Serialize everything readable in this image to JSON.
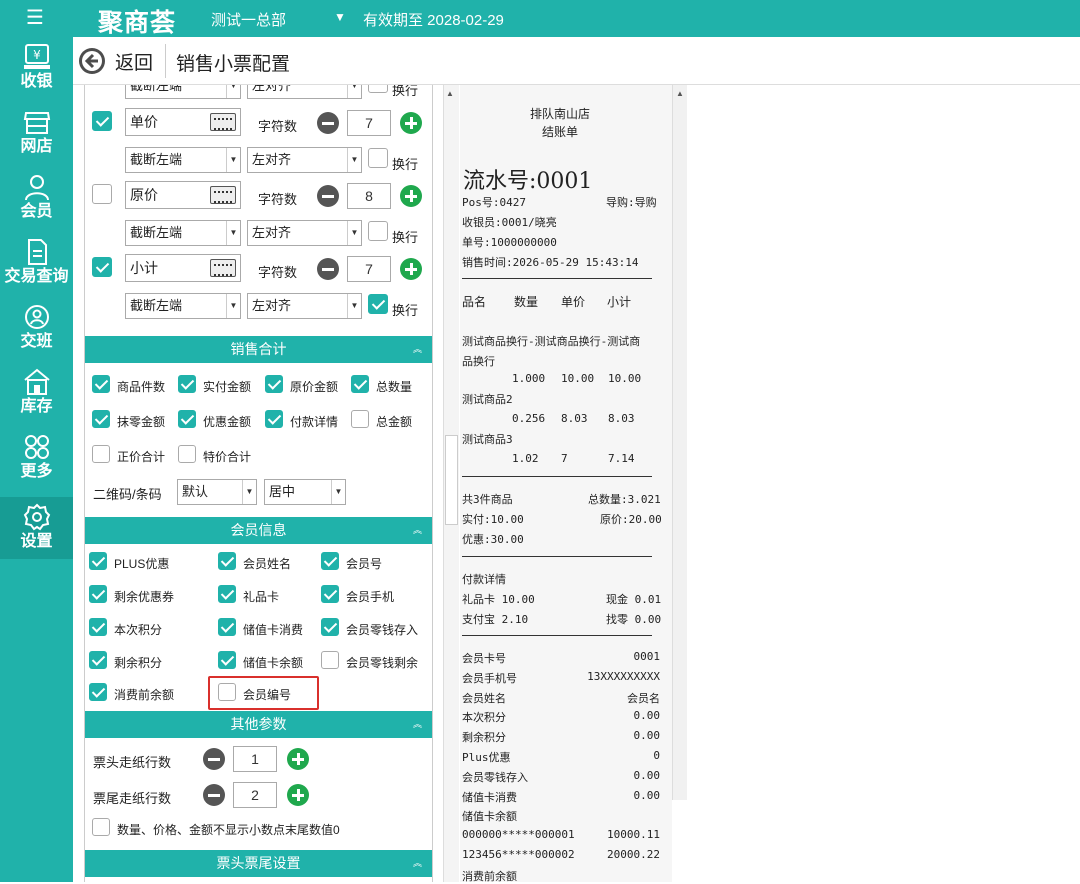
{
  "topbar": {
    "logo": "聚商荟",
    "store": "测试一总部",
    "expiry": "有效期至 2028-02-29"
  },
  "sidebar": {
    "items": [
      {
        "label": "收银",
        "icon": "cashier-icon"
      },
      {
        "label": "网店",
        "icon": "shop-icon"
      },
      {
        "label": "会员",
        "icon": "member-icon"
      },
      {
        "label": "交易查询",
        "icon": "transaction-icon"
      },
      {
        "label": "交班",
        "icon": "handover-icon"
      },
      {
        "label": "库存",
        "icon": "inventory-icon"
      },
      {
        "label": "更多",
        "icon": "more-icon"
      },
      {
        "label": "设置",
        "icon": "settings-icon",
        "active": true
      }
    ]
  },
  "header": {
    "back": "返回",
    "title": "销售小票配置"
  },
  "fields": {
    "truncate": "截断左端",
    "align": "左对齐",
    "wrap": "换行",
    "chars": "字符数",
    "rows": [
      {
        "name": "单价",
        "checked": true,
        "count": "7",
        "wrap_checked": false
      },
      {
        "name": "原价",
        "checked": false,
        "count": "8",
        "wrap_checked": false
      },
      {
        "name": "小计",
        "checked": true,
        "count": "7",
        "wrap_checked": true
      }
    ]
  },
  "sales_total": {
    "title": "销售合计",
    "items": [
      {
        "label": "商品件数",
        "checked": true
      },
      {
        "label": "实付金额",
        "checked": true
      },
      {
        "label": "原价金额",
        "checked": true
      },
      {
        "label": "总数量",
        "checked": true
      },
      {
        "label": "抹零金额",
        "checked": true
      },
      {
        "label": "优惠金额",
        "checked": true
      },
      {
        "label": "付款详情",
        "checked": true
      },
      {
        "label": "总金额",
        "checked": false
      },
      {
        "label": "正价合计",
        "checked": false
      },
      {
        "label": "特价合计",
        "checked": false
      }
    ],
    "qr_label": "二维码/条码",
    "qr_value": "默认",
    "qr_align": "居中"
  },
  "member_info": {
    "title": "会员信息",
    "items": [
      {
        "label": "PLUS优惠",
        "checked": true
      },
      {
        "label": "会员姓名",
        "checked": true
      },
      {
        "label": "会员号",
        "checked": true
      },
      {
        "label": "剩余优惠券",
        "checked": true
      },
      {
        "label": "礼品卡",
        "checked": true
      },
      {
        "label": "会员手机",
        "checked": true
      },
      {
        "label": "本次积分",
        "checked": true
      },
      {
        "label": "储值卡消费",
        "checked": true
      },
      {
        "label": "会员零钱存入",
        "checked": true
      },
      {
        "label": "剩余积分",
        "checked": true
      },
      {
        "label": "储值卡余额",
        "checked": true
      },
      {
        "label": "会员零钱剩余",
        "checked": false
      },
      {
        "label": "消费前余额",
        "checked": true
      },
      {
        "label": "会员编号",
        "checked": false
      }
    ]
  },
  "other_params": {
    "title": "其他参数",
    "head_feed_label": "票头走纸行数",
    "head_feed": "1",
    "tail_feed_label": "票尾走纸行数",
    "tail_feed": "2",
    "no_decimal_label": "数量、价格、金额不显示小数点末尾数值0"
  },
  "head_tail": {
    "title": "票头票尾设置"
  },
  "receipt": {
    "store": "排队南山店",
    "doc_type": "结账单",
    "serial": "流水号:0001",
    "pos": "Pos号:0427",
    "guide": "导购:导购",
    "cashier": "收银员:0001/晓亮",
    "order_no": "单号:1000000000",
    "sale_time": "销售时间:2026-05-29 15:43:14",
    "headers": [
      "品名",
      "数量",
      "单价",
      "小计"
    ],
    "item1_name_a": "测试商品换行-测试商品换行-测试商",
    "item1_name_b": "品换行",
    "item1_vals": [
      "1.000",
      "10.00",
      "10.00"
    ],
    "item2_name": "测试商品2",
    "item2_vals": [
      "0.256",
      "8.03",
      "8.03"
    ],
    "item3_name": "测试商品3",
    "item3_vals": [
      "1.02",
      "7",
      "7.14"
    ],
    "total_items": "共3件商品",
    "total_qty": "总数量:3.021",
    "paid": "实付:10.00",
    "orig": "原价:20.00",
    "discount": "优惠:30.00",
    "pay_detail": "付款详情",
    "gift_card": "礼品卡 10.00",
    "cash": "现金 0.01",
    "alipay": "支付宝 2.10",
    "change": "找零 0.00",
    "member_lines": [
      {
        "k": "会员卡号",
        "v": "0001"
      },
      {
        "k": "会员手机号",
        "v": "13XXXXXXXXX"
      },
      {
        "k": "会员姓名",
        "v": "会员名"
      },
      {
        "k": "本次积分",
        "v": "0.00"
      },
      {
        "k": "剩余积分",
        "v": "0.00"
      },
      {
        "k": "Plus优惠",
        "v": "0"
      },
      {
        "k": "会员零钱存入",
        "v": "0.00"
      },
      {
        "k": "储值卡消费",
        "v": "0.00"
      },
      {
        "k": "储值卡余额",
        "v": ""
      },
      {
        "k": "000000*****000001",
        "v": "10000.11"
      },
      {
        "k": "123456*****000002",
        "v": "20000.22"
      },
      {
        "k": "消费前余额",
        "v": ""
      }
    ]
  }
}
